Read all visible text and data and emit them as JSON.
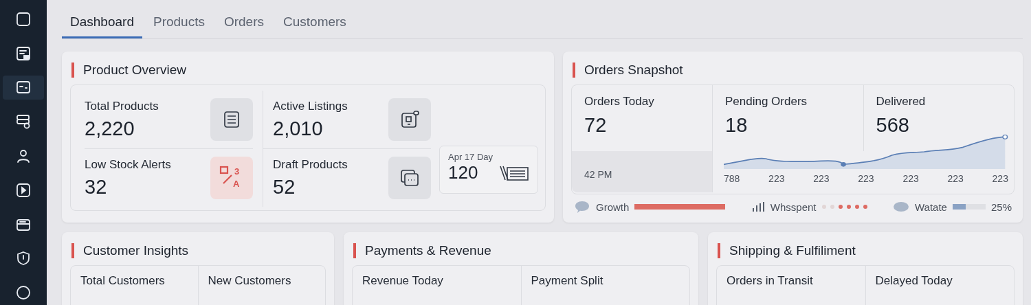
{
  "sidebar": {
    "items": [
      {
        "selected": false
      },
      {
        "selected": false
      },
      {
        "selected": true
      },
      {
        "selected": false
      },
      {
        "selected": false
      },
      {
        "selected": false
      },
      {
        "selected": false
      },
      {
        "selected": false
      },
      {
        "selected": false
      }
    ]
  },
  "tabs": [
    {
      "label": "Dashboard",
      "selected": true
    },
    {
      "label": "Products",
      "selected": false
    },
    {
      "label": "Orders",
      "selected": false
    },
    {
      "label": "Customers",
      "selected": false
    }
  ],
  "product_overview": {
    "title": "Product Overview",
    "stats": [
      {
        "label": "Total Products",
        "value": "2,220",
        "kind": "plain"
      },
      {
        "label": "Active Listings",
        "value": "2,010",
        "kind": "plain"
      },
      {
        "label": "Low Stock Alerts",
        "value": "32",
        "kind": "alert",
        "icon_text": [
          "3",
          "A"
        ]
      },
      {
        "label": "Draft Products",
        "value": "52",
        "kind": "plain"
      }
    ],
    "day_card": {
      "label": "Apr 17 Day",
      "value": "120"
    }
  },
  "orders_snapshot": {
    "title": "Orders Snapshot",
    "stats": [
      {
        "label": "Orders Today",
        "value": "72"
      },
      {
        "label": "Pending Orders",
        "value": "18"
      },
      {
        "label": "Delivered",
        "value": "568"
      }
    ],
    "time": "42 PM",
    "axis_labels": [
      "788",
      "223",
      "223",
      "223",
      "223",
      "223",
      "223"
    ],
    "legend": [
      {
        "kind": "bar",
        "label": "Growth",
        "level": 1.0
      },
      {
        "kind": "dots",
        "label": "Whsspent",
        "dots": [
          {
            "on": false
          },
          {
            "on": false
          },
          {
            "on": true
          },
          {
            "on": true
          },
          {
            "on": true
          },
          {
            "on": true
          }
        ]
      },
      {
        "kind": "bar",
        "label": "Watate",
        "level": 0.4,
        "reading": "25%"
      }
    ]
  },
  "bottom_cards": [
    {
      "title": "Customer Insights",
      "labels": [
        "Total Customers",
        "New Customers"
      ]
    },
    {
      "title": "Payments & Revenue",
      "labels": [
        "Revenue Today",
        "Payment Split"
      ]
    },
    {
      "title": "Shipping & Fulfiliment",
      "labels": [
        "Orders in Transit",
        "Delayed Today"
      ]
    }
  ]
}
